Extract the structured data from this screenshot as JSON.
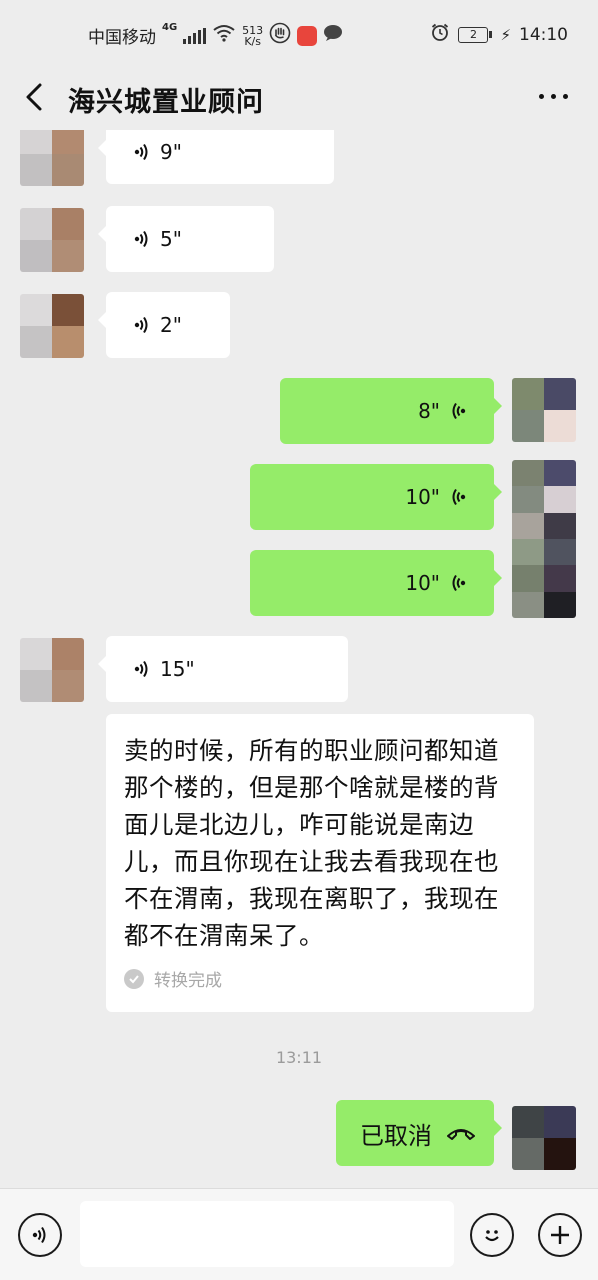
{
  "status_bar": {
    "carrier": "中国移动",
    "network": "4G",
    "speed_value": "513",
    "speed_unit": "K/s",
    "sim_badge": "2",
    "time": "14:10"
  },
  "header": {
    "title": "海兴城置业顾问"
  },
  "messages": [
    {
      "direction": "in",
      "type": "voice",
      "duration": "9\""
    },
    {
      "direction": "in",
      "type": "voice",
      "duration": "5\""
    },
    {
      "direction": "in",
      "type": "voice",
      "duration": "2\""
    },
    {
      "direction": "out",
      "type": "voice",
      "duration": "8\""
    },
    {
      "direction": "out",
      "type": "voice",
      "duration": "10\""
    },
    {
      "direction": "out",
      "type": "voice",
      "duration": "10\""
    },
    {
      "direction": "in",
      "type": "voice",
      "duration": "15\""
    }
  ],
  "transcript": {
    "text": "卖的时候，所有的职业顾问都知道那个楼的，但是那个啥就是楼的背面儿是北边儿，咋可能说是南边儿，而且你现在让我去看我现在也不在渭南，我现在离职了，我现在都不在渭南呆了。",
    "status": "转换完成"
  },
  "timestamp": "13:11",
  "call_message": {
    "direction": "out",
    "text": "已取消"
  },
  "icons": {
    "back": "chevron-left-icon",
    "more": "more-dots-icon",
    "voice": "voice-wave-icon",
    "check": "check-circle-icon",
    "phone": "phone-hangup-icon",
    "voice_input": "voice-input-icon",
    "emoji": "emoji-icon",
    "plus": "plus-icon"
  },
  "colors": {
    "chat_bg": "#ededed",
    "outgoing_bubble": "#95ec69",
    "incoming_bubble": "#ffffff"
  }
}
